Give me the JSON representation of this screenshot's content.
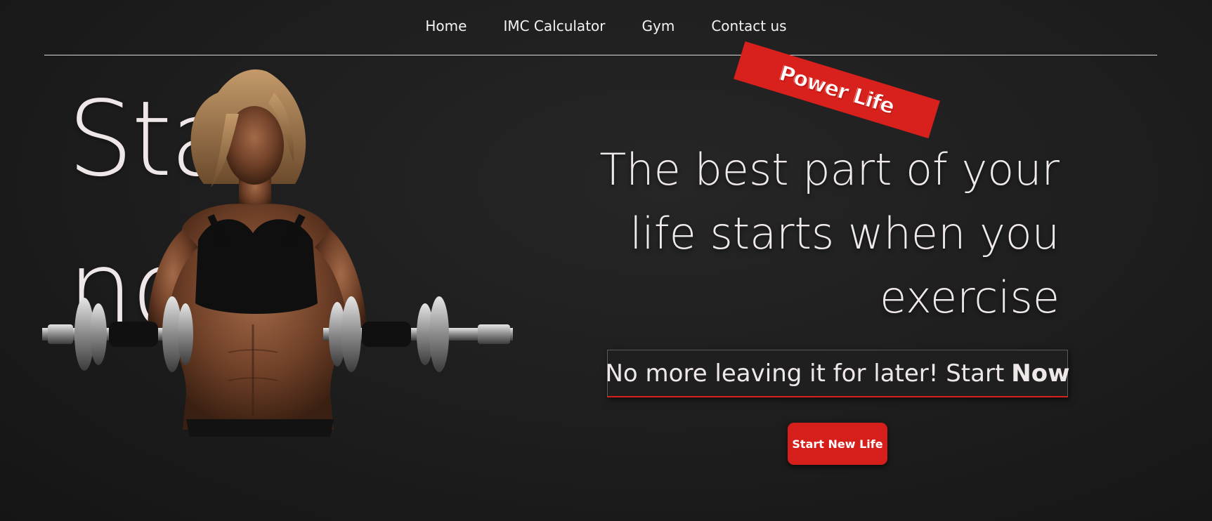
{
  "nav": {
    "items": [
      {
        "label": "Home"
      },
      {
        "label": "IMC Calculator"
      },
      {
        "label": "Gym"
      },
      {
        "label": "Contact us"
      }
    ]
  },
  "hero": {
    "big_line_1": "Star",
    "big_line_2": "no",
    "stamp": "Power Life",
    "title": "The best part of your life starts when you exercise",
    "tagline_prefix": "No more leaving it for later! Start",
    "tagline_strong": "Now",
    "cta_label": "Start New Life"
  },
  "colors": {
    "background": "#1c1c1c",
    "accent": "#d8201c",
    "text": "#f0e9e9"
  },
  "icons": [
    "woman-with-dumbbells-photo"
  ]
}
